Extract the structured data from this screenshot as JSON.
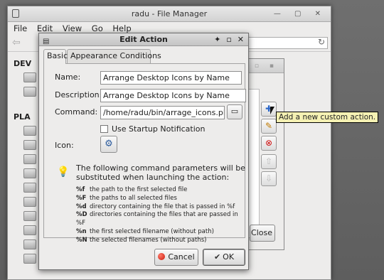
{
  "fm": {
    "title": "radu - File Manager",
    "menu": [
      "File",
      "Edit",
      "View",
      "Go",
      "Help"
    ],
    "side_dev": "DEV",
    "side_pla": "PLA",
    "controls": "— ▢ ✕"
  },
  "custom_actions": {
    "title_controls": "+ ▫ ▪",
    "add_glyph": "✚",
    "edit_glyph": "✎",
    "delete_glyph": "⊗",
    "up_glyph": "⇧",
    "down_glyph": "⇩",
    "close_label": "Close"
  },
  "tooltip": {
    "text": "Add a new custom action."
  },
  "dialog": {
    "title": "Edit Action",
    "title_controls": [
      "✦",
      "▫",
      "✕"
    ],
    "tabs": [
      "Basic",
      "Appearance Conditions"
    ],
    "name_label": "Name:",
    "name_value": "Arrange Desktop Icons by Name",
    "description_label": "Description:",
    "description_value": "Arrange Desktop Icons by Name",
    "command_label": "Command:",
    "command_value": "/home/radu/bin/arrage_icons.pl",
    "startup_label": "Use Startup Notification",
    "icon_label": "Icon:",
    "info_text": "The following command parameters will be substituted when launching the action:",
    "params": [
      {
        "code": "%f",
        "desc": "the path to the first selected file"
      },
      {
        "code": "%F",
        "desc": "the paths to all selected files"
      },
      {
        "code": "%d",
        "desc": "directory containing the file that is passed in %f"
      },
      {
        "code": "%D",
        "desc": "directories containing the files that are passed in %F"
      },
      {
        "code": "%n",
        "desc": "the first selected filename (without path)"
      },
      {
        "code": "%N",
        "desc": "the selected filenames (without paths)"
      }
    ],
    "cancel_label": "Cancel",
    "ok_label": "OK"
  }
}
